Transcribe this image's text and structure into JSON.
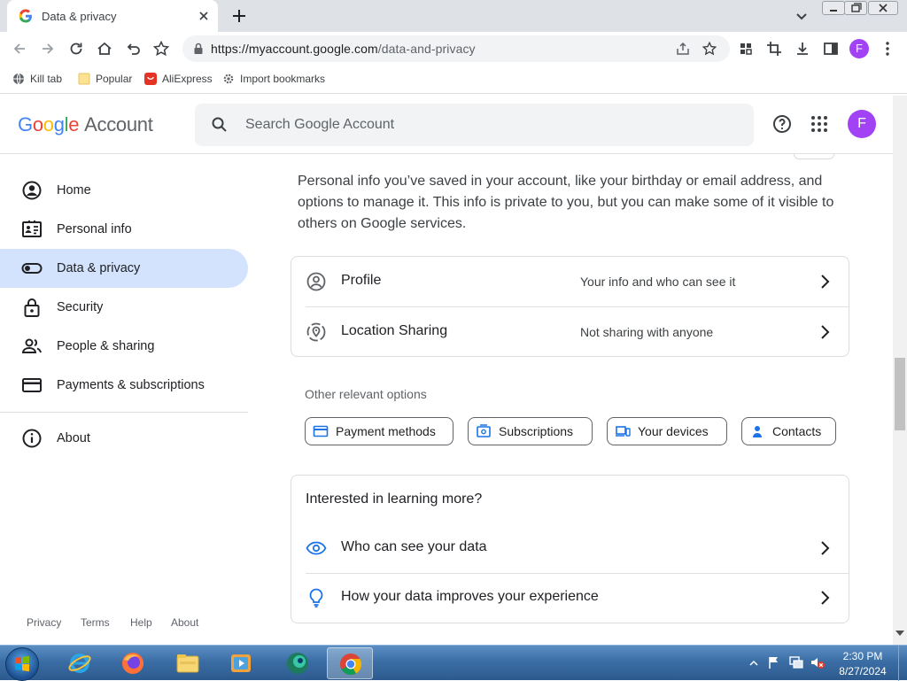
{
  "browser": {
    "tab_title": "Data & privacy",
    "url_host": "https://myaccount.google.com",
    "url_path": "/data-and-privacy",
    "avatar_letter": "F",
    "bookmarks": [
      {
        "label": "Kill tab",
        "icon": "globe-icon"
      },
      {
        "label": "Popular",
        "icon": "folder-icon"
      },
      {
        "label": "AliExpress",
        "icon": "aliexpress-icon"
      },
      {
        "label": "Import bookmarks",
        "icon": "gear-icon"
      }
    ]
  },
  "header": {
    "logo_google": "Google",
    "logo_account": "Account",
    "search_placeholder": "Search Google Account",
    "avatar_letter": "F"
  },
  "sidebar": {
    "items": [
      {
        "label": "Home",
        "icon": "account-circle-icon",
        "active": false
      },
      {
        "label": "Personal info",
        "icon": "id-card-icon",
        "active": false
      },
      {
        "label": "Data & privacy",
        "icon": "toggle-icon",
        "active": true
      },
      {
        "label": "Security",
        "icon": "lock-icon",
        "active": false
      },
      {
        "label": "People & sharing",
        "icon": "people-icon",
        "active": false
      },
      {
        "label": "Payments & subscriptions",
        "icon": "credit-card-icon",
        "active": false
      }
    ],
    "about": {
      "label": "About",
      "icon": "info-icon"
    },
    "footer": [
      "Privacy",
      "Terms",
      "Help",
      "About"
    ]
  },
  "main": {
    "intro": "Personal info you’ve saved in your account, like your birthday or email address, and options to manage it. This info is private to you, but you can make some of it visible to others on Google services.",
    "rows": [
      {
        "title": "Profile",
        "desc": "Your info and who can see it",
        "icon": "profile-icon"
      },
      {
        "title": "Location Sharing",
        "desc": "Not sharing with anyone",
        "icon": "location-sharing-icon"
      }
    ],
    "other_label": "Other relevant options",
    "chips": [
      {
        "label": "Payment methods",
        "icon": "credit-card-icon"
      },
      {
        "label": "Subscriptions",
        "icon": "subscriptions-icon"
      },
      {
        "label": "Your devices",
        "icon": "devices-icon"
      },
      {
        "label": "Contacts",
        "icon": "contacts-icon"
      }
    ],
    "learn": {
      "title": "Interested in learning more?",
      "rows": [
        {
          "title": "Who can see your data",
          "icon": "eye-icon"
        },
        {
          "title": "How your data improves your experience",
          "icon": "lightbulb-icon"
        }
      ]
    }
  },
  "taskbar": {
    "apps": [
      "internet-explorer-icon",
      "firefox-icon",
      "file-explorer-icon",
      "media-player-icon",
      "browser-app-icon",
      "chrome-icon"
    ],
    "time": "2:30 PM",
    "date": "8/27/2024"
  },
  "colors": {
    "accent": "#1a73e8",
    "active_nav": "#d3e3fd",
    "avatar": "#a142f4"
  }
}
